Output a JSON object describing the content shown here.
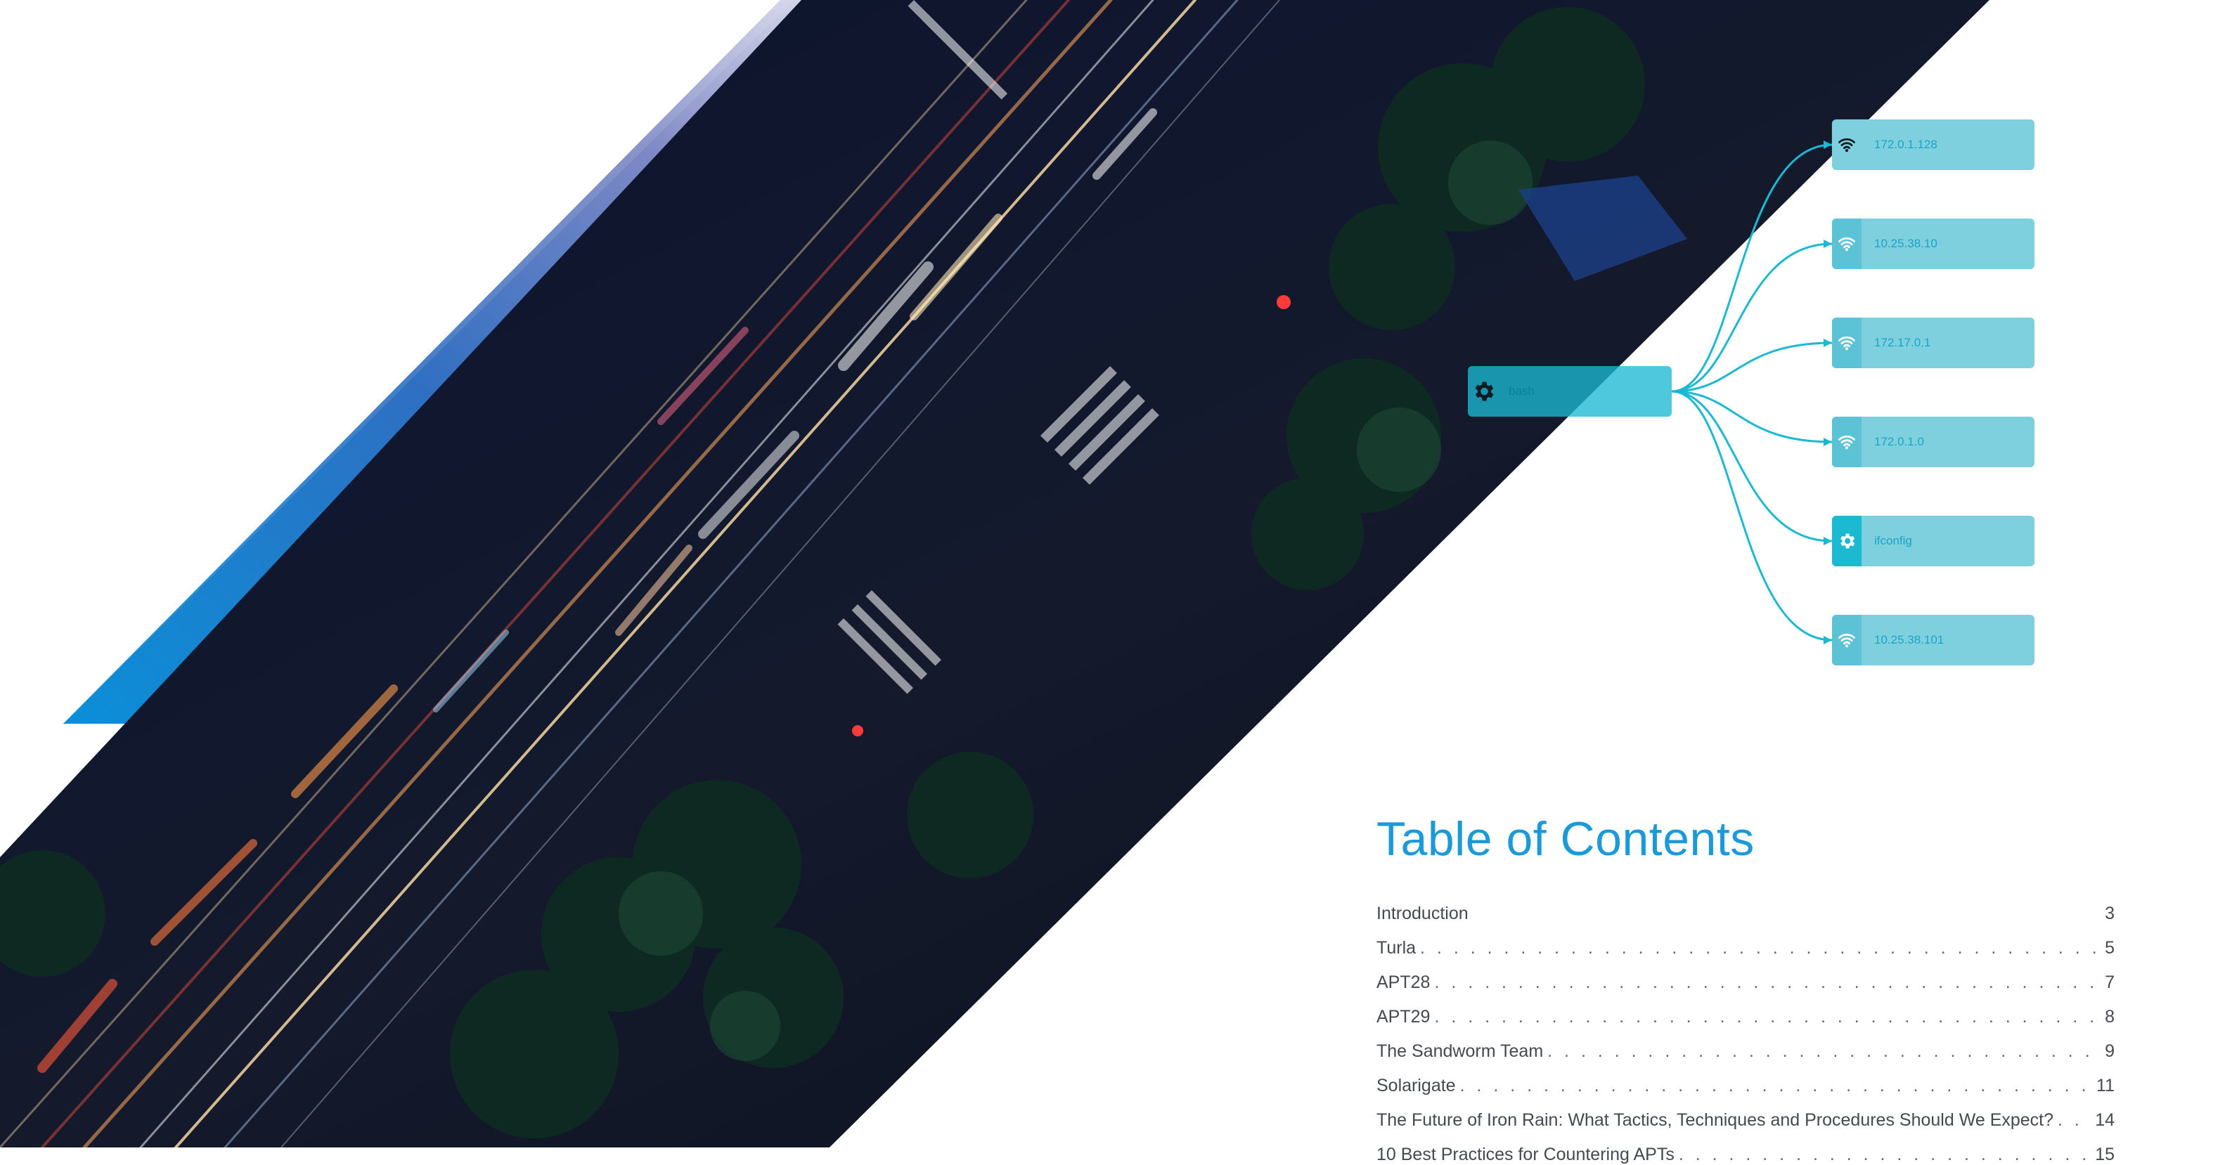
{
  "diagram": {
    "source_node": {
      "label": "bash",
      "icon": "gear-icon"
    },
    "target_nodes": [
      {
        "label": "172.0.1.128",
        "icon": "wifi-icon",
        "icon_style": "dark"
      },
      {
        "label": "10.25.38.10",
        "icon": "wifi-icon",
        "icon_style": "light"
      },
      {
        "label": "172.17.0.1",
        "icon": "wifi-icon",
        "icon_style": "light"
      },
      {
        "label": "172.0.1.0",
        "icon": "wifi-icon",
        "icon_style": "light"
      },
      {
        "label": "ifconfig",
        "icon": "gear-icon",
        "icon_style": "light"
      },
      {
        "label": "10.25.38.101",
        "icon": "wifi-icon",
        "icon_style": "light"
      }
    ],
    "connector_color": "#1bb9d2"
  },
  "toc": {
    "title": "Table of Contents",
    "entries": [
      {
        "title": "Introduction",
        "page": "3",
        "dotted": false
      },
      {
        "title": "Turla",
        "page": "5",
        "dotted": true
      },
      {
        "title": "APT28",
        "page": "7",
        "dotted": true
      },
      {
        "title": "APT29",
        "page": "8",
        "dotted": true
      },
      {
        "title": "The Sandworm Team",
        "page": "9",
        "dotted": true
      },
      {
        "title": "Solarigate",
        "page": "11",
        "dotted": true
      },
      {
        "title": "The Future of Iron Rain: What Tactics, Techniques and Procedures Should We Expect?",
        "page": "14",
        "dotted": true
      },
      {
        "title": "10 Best Practices for Countering APTs",
        "page": "15",
        "dotted": true
      }
    ]
  },
  "colors": {
    "accent_blue": "#1a9ad8",
    "node_fill": "#7fd0df",
    "text": "#444a52"
  }
}
